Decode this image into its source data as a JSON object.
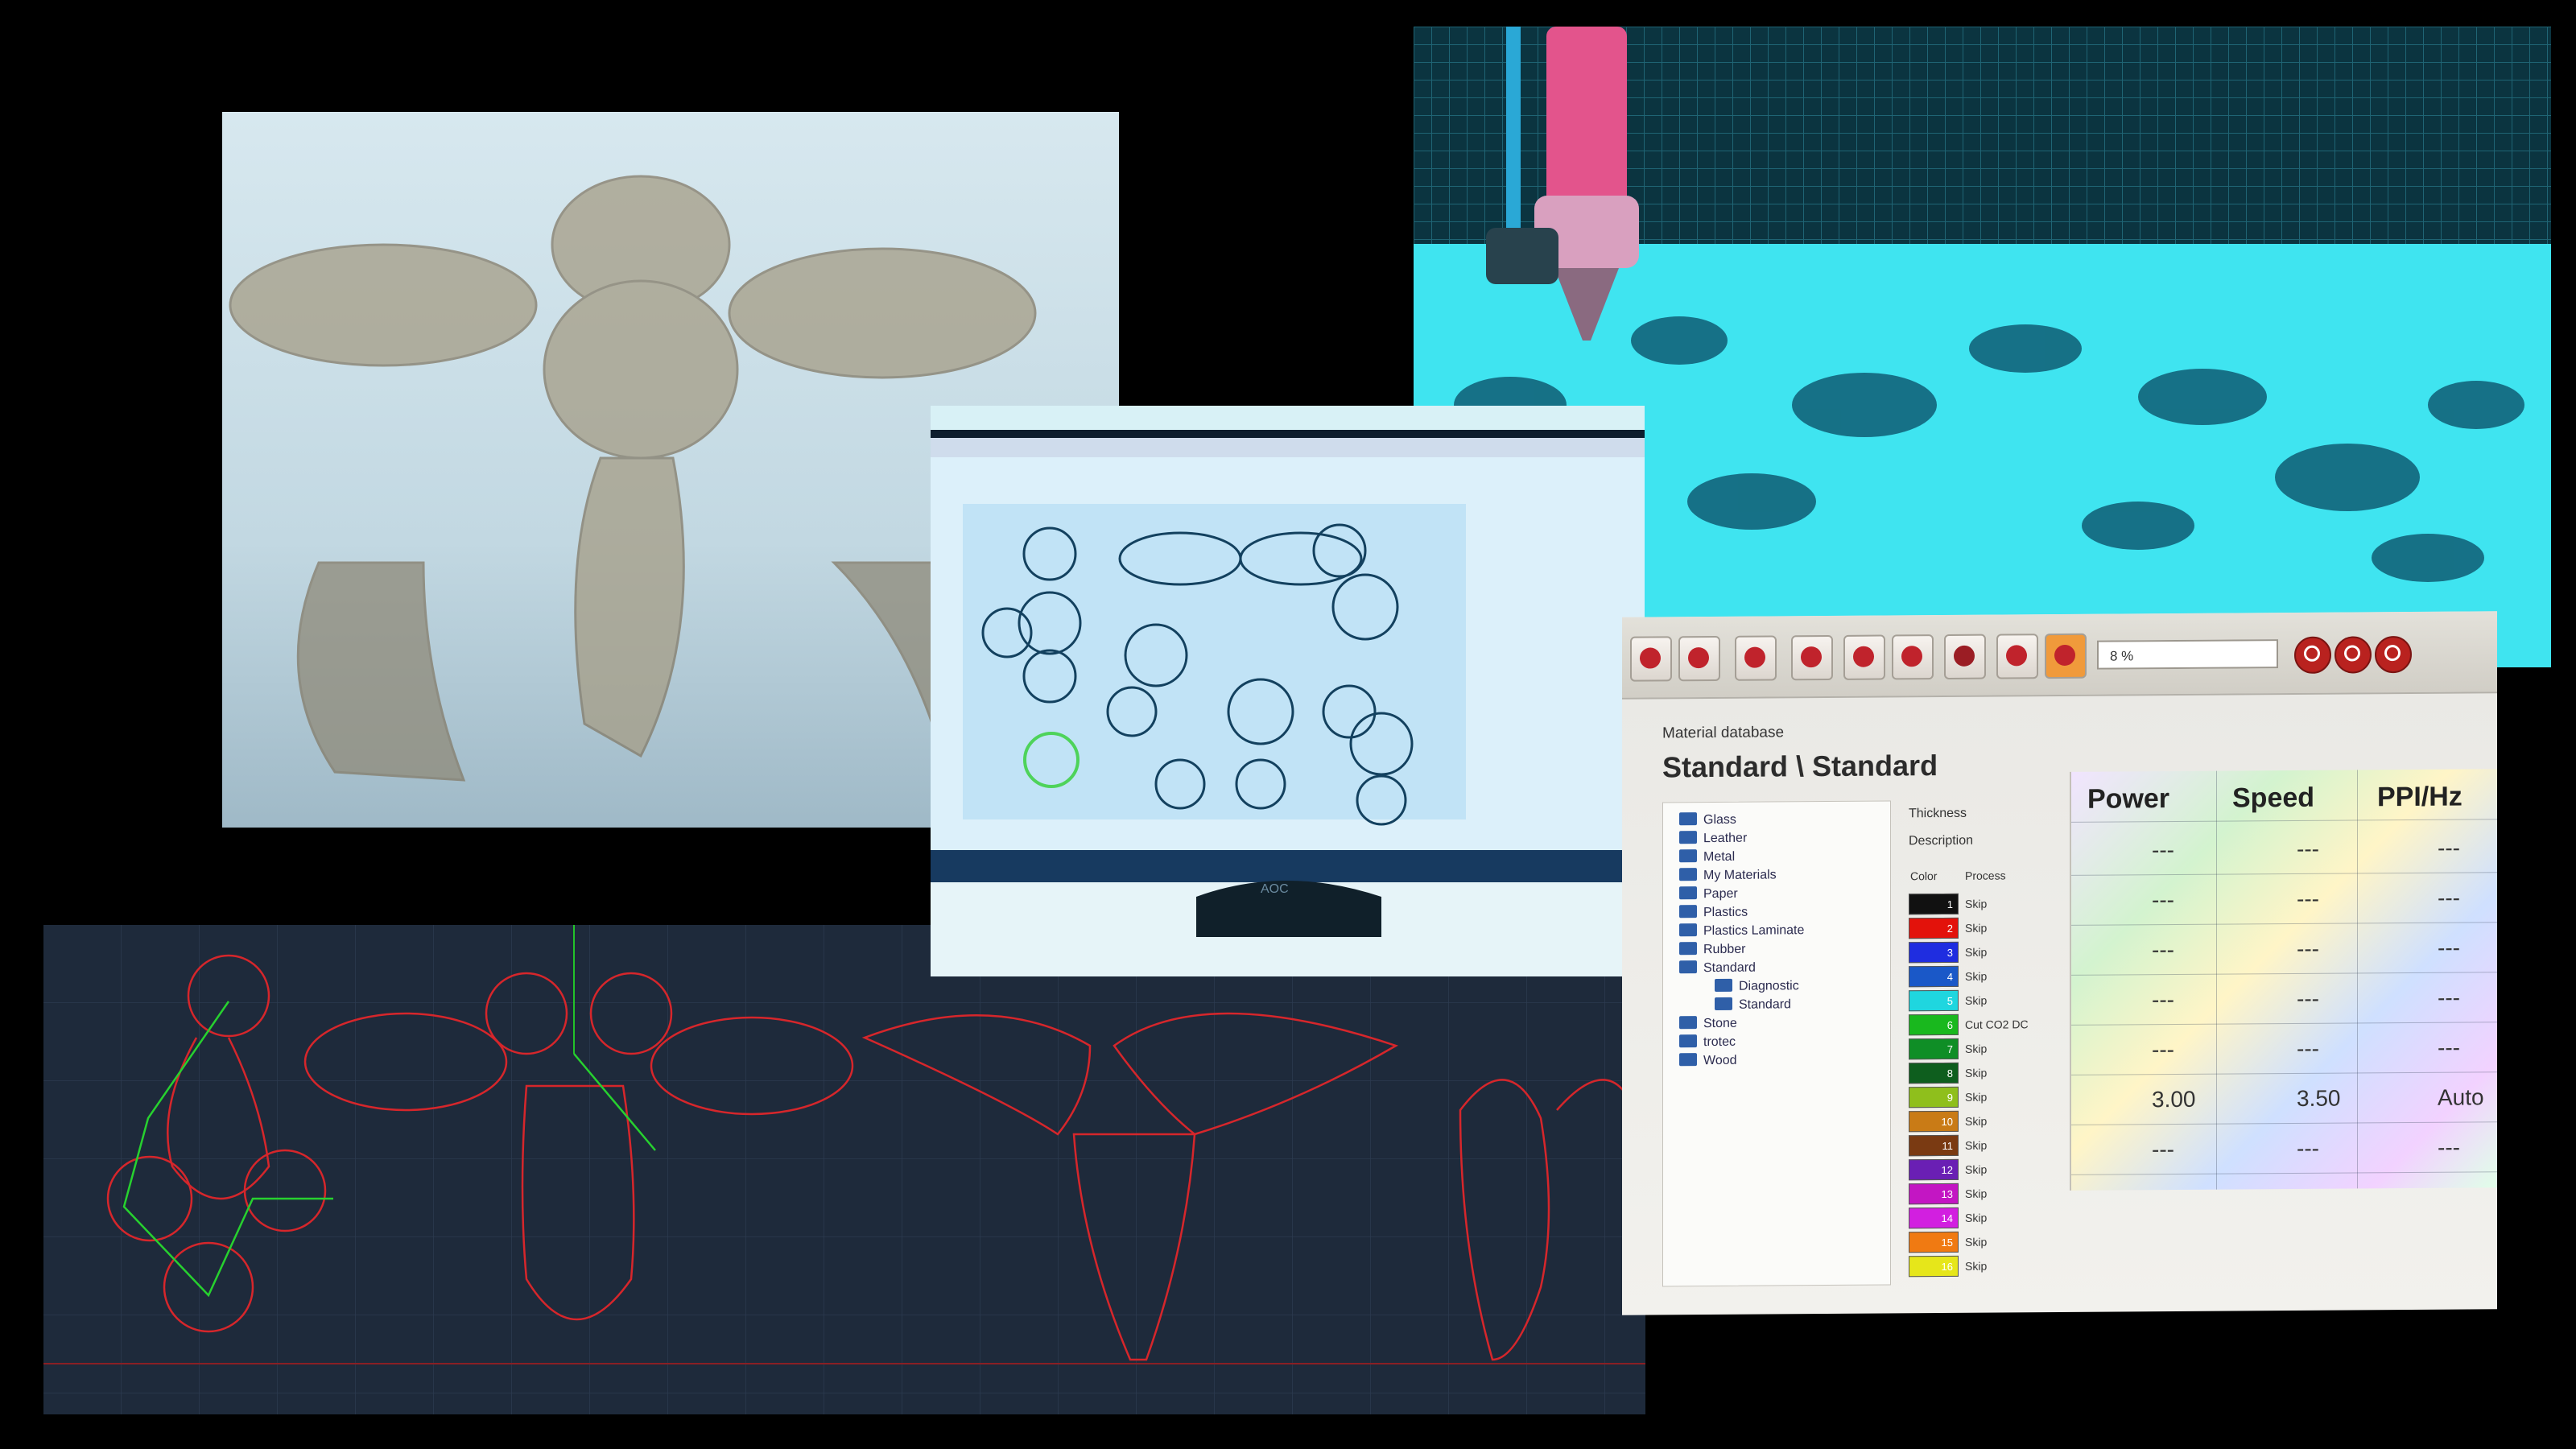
{
  "monitor_photo": {
    "brand": "AOC"
  },
  "material_database": {
    "zoom_value": "8 %",
    "dialog_title": "Material database",
    "path": "Standard \\ Standard",
    "tree": [
      {
        "label": "Glass"
      },
      {
        "label": "Leather"
      },
      {
        "label": "Metal"
      },
      {
        "label": "My Materials"
      },
      {
        "label": "Paper"
      },
      {
        "label": "Plastics"
      },
      {
        "label": "Plastics Laminate"
      },
      {
        "label": "Rubber"
      },
      {
        "label": "Standard"
      },
      {
        "label": "Diagnostic",
        "child": true
      },
      {
        "label": "Standard",
        "child": true
      },
      {
        "label": "Stone"
      },
      {
        "label": "trotec"
      },
      {
        "label": "Wood"
      }
    ],
    "fields": {
      "thickness": "Thickness",
      "description": "Description"
    },
    "columns": {
      "color": "Color",
      "process": "Process",
      "power": "Power",
      "speed": "Speed",
      "ppi": "PPI/Hz"
    },
    "rows": [
      {
        "n": "1",
        "color": "#111111",
        "process": "Skip"
      },
      {
        "n": "2",
        "color": "#e3120b",
        "process": "Skip"
      },
      {
        "n": "3",
        "color": "#1f2de0",
        "process": "Skip"
      },
      {
        "n": "4",
        "color": "#1a58c8",
        "process": "Skip"
      },
      {
        "n": "5",
        "color": "#1fd6df",
        "process": "Skip"
      },
      {
        "n": "6",
        "color": "#19b81e",
        "process": "Cut CO2 DC"
      },
      {
        "n": "7",
        "color": "#0f8e26",
        "process": "Skip"
      },
      {
        "n": "8",
        "color": "#0e5e1e",
        "process": "Skip"
      },
      {
        "n": "9",
        "color": "#8fbf1c",
        "process": "Skip"
      },
      {
        "n": "10",
        "color": "#c97b16",
        "process": "Skip"
      },
      {
        "n": "11",
        "color": "#7a3a12",
        "process": "Skip"
      },
      {
        "n": "12",
        "color": "#6a1fb4",
        "process": "Skip"
      },
      {
        "n": "13",
        "color": "#c316c3",
        "process": "Skip"
      },
      {
        "n": "14",
        "color": "#d21fe0",
        "process": "Skip"
      },
      {
        "n": "15",
        "color": "#f07a12",
        "process": "Skip"
      },
      {
        "n": "16",
        "color": "#e6e61a",
        "process": "Skip"
      }
    ],
    "grid_rows": [
      {
        "power": "---",
        "speed": "---",
        "ppi": "---"
      },
      {
        "power": "---",
        "speed": "---",
        "ppi": "---"
      },
      {
        "power": "---",
        "speed": "---",
        "ppi": "---"
      },
      {
        "power": "---",
        "speed": "---",
        "ppi": "---"
      },
      {
        "power": "---",
        "speed": "---",
        "ppi": "---"
      },
      {
        "power": "3.00",
        "speed": "3.50",
        "ppi": "Auto"
      },
      {
        "power": "---",
        "speed": "---",
        "ppi": "---"
      }
    ]
  }
}
